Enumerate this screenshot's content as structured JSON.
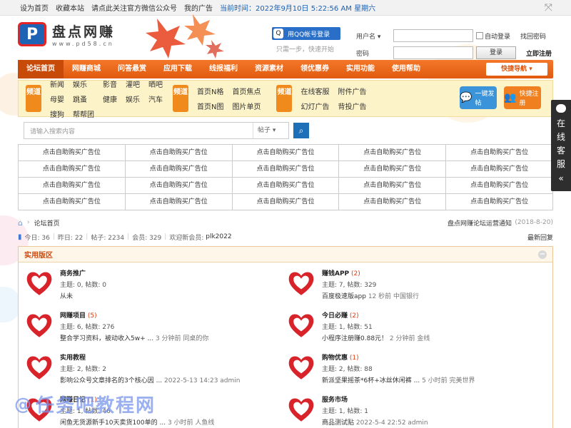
{
  "topbar": {
    "links": [
      "设为首页",
      "收藏本站",
      "请点此关注官方微信公众号",
      "我的广告"
    ],
    "time_label": "当前时间：2022年9月10日 5:22:56 AM 星期六"
  },
  "header": {
    "logo_text": "盘点网赚",
    "logo_url": "www.pd58.cn",
    "qq_login": "用QQ帐号登录",
    "qq_sub": "只需一步，快速开始",
    "username_label": "用户名",
    "password_label": "密码",
    "auto_login": "自动登录",
    "find_password": "找回密码",
    "login_button": "登录",
    "register": "立即注册"
  },
  "nav": {
    "items": [
      "论坛首页",
      "网赚商城",
      "问答悬赏",
      "应用下载",
      "线报福利",
      "资源素材",
      "领优惠券",
      "实用功能",
      "使用帮助"
    ],
    "quick_nav": "快捷导航"
  },
  "channels": {
    "tag": "频道",
    "group1": [
      "新闻",
      "娱乐",
      "影音",
      "灌吧",
      "晒吧",
      "母婴",
      "跳蚤",
      "健康",
      "娱乐",
      "汽车",
      "搜狗",
      "帮帮团"
    ],
    "group2": [
      "首页N格",
      "首页焦点",
      "首页N图",
      "图片单页"
    ],
    "group3": [
      "在线客服",
      "附件广告",
      "幻灯广告",
      "背投广告"
    ],
    "post_btn": "一键发帖",
    "reg_btn": "快捷注册"
  },
  "search": {
    "placeholder": "请输入搜索内容",
    "type": "帖子"
  },
  "ads": {
    "label": "点击自助购买广告位"
  },
  "breadcrumb": {
    "current": "论坛首页",
    "notice": "盘点网赚论坛运营通知",
    "notice_date": "(2018-8-20)"
  },
  "stats": {
    "today": "今日: 36",
    "yesterday": "昨日: 22",
    "posts": "帖子: 2234",
    "members": "会员: 329",
    "newest_label": "欢迎新会员:",
    "newest_user": "plk2022",
    "latest_reply": "最新回复"
  },
  "forum": {
    "section_title": "实用版区",
    "boards": [
      {
        "name": "商务推广",
        "new": "",
        "meta": "主题: 0, 帖数: 0",
        "last": "从未",
        "time": ""
      },
      {
        "name": "赚钱APP",
        "new": "(2)",
        "meta": "主题: 7, 帖数: 329",
        "last": "百度极速版app",
        "time": "12 秒前 中国银行"
      },
      {
        "name": "网赚项目",
        "new": "(5)",
        "meta": "主题: 6, 帖数: 276",
        "last": "整合学习资料，被动收入5w+ ...",
        "time": "3 分钟前 同桌的你"
      },
      {
        "name": "今日必赚",
        "new": "(2)",
        "meta": "主题: 1, 帖数: 51",
        "last": "小程序注册赚0.88元！",
        "time": "2 分钟前 金线"
      },
      {
        "name": "实用教程",
        "new": "",
        "meta": "主题: 2, 帖数: 2",
        "last": "影响公众号文章排名的3个核心因 ...",
        "time": "2022-5-13 14:23 admin"
      },
      {
        "name": "购物优惠",
        "new": "(1)",
        "meta": "主题: 2, 帖数: 88",
        "last": "新派坚果摇茶*6杯+冰丝休闲裤 ...",
        "time": "5 小时前 完美世界"
      },
      {
        "name": "网赚日记",
        "new": "(1)",
        "meta": "主题: 1, 帖数: 46",
        "last": "闲鱼无货源新手10天卖货100单的 ...",
        "time": "3 小时前 人鱼线"
      },
      {
        "name": "服务市场",
        "new": "",
        "meta": "主题: 1, 帖数: 1",
        "last": "商品测试贴",
        "time": "2022-5-4 22:52 admin"
      }
    ]
  },
  "service": {
    "label": "在线客服",
    "arrow": "«"
  },
  "watermark": "任务吧教程网",
  "colors": {
    "nav": "#e8651a",
    "accent": "#d04a0c",
    "link_blue": "#1a5fb4",
    "channel_bg": "#fdf3c8"
  }
}
